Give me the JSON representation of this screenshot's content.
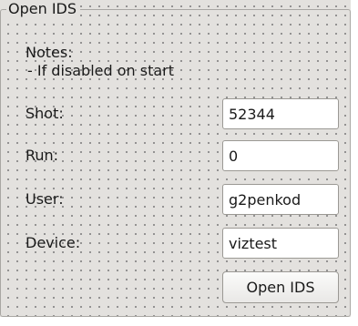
{
  "group": {
    "title": "Open IDS"
  },
  "notes": {
    "title": "Notes:",
    "line1": "- If disabled on start"
  },
  "form": {
    "shot": {
      "label": "Shot:",
      "value": "52344"
    },
    "run": {
      "label": "Run:",
      "value": "0"
    },
    "user": {
      "label": "User:",
      "value": "g2penkod"
    },
    "device": {
      "label": "Device:",
      "value": "viztest"
    }
  },
  "actions": {
    "open_ids_label": "Open IDS"
  },
  "colors": {
    "canvas": "#e3e1de",
    "grid_dot": "#6e6e6e",
    "field_background": "#ffffff",
    "border": "#9b9994"
  }
}
